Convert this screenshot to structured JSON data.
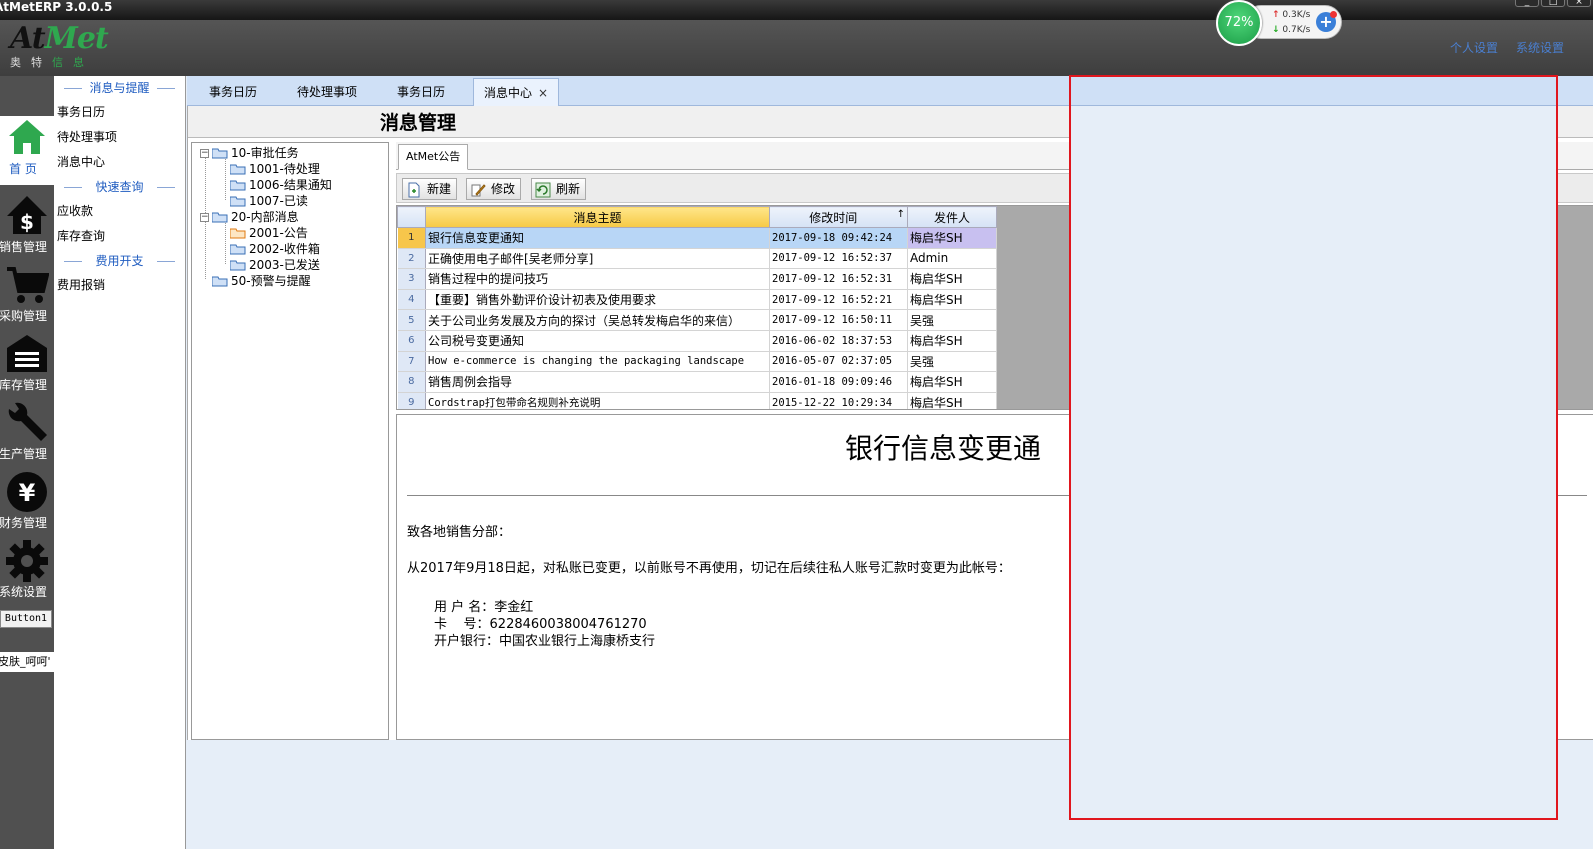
{
  "app": {
    "title": "AtMetERP 3.0.0.5",
    "window_buttons": [
      "_",
      "□",
      "×"
    ]
  },
  "logo": {
    "mark_a": "At",
    "mark_b": "Met",
    "sub_a": "奥特",
    "sub_b": "信息"
  },
  "header": {
    "personal_settings": "个人设置",
    "system_settings": "系统设置"
  },
  "net_widget": {
    "percent": "72%",
    "up": "0.3K/s",
    "down": "0.7K/s",
    "plus": "+"
  },
  "nav": [
    {
      "label": "首 页",
      "icon": "home-icon"
    },
    {
      "label": "销售管理",
      "icon": "dollar-house-icon"
    },
    {
      "label": "采购管理",
      "icon": "cart-icon"
    },
    {
      "label": "库存管理",
      "icon": "warehouse-icon"
    },
    {
      "label": "生产管理",
      "icon": "wrench-icon"
    },
    {
      "label": "财务管理",
      "icon": "yen-icon"
    },
    {
      "label": "系统设置",
      "icon": "gear-icon"
    }
  ],
  "button1": "Button1",
  "skin": "皮肤_呵呵'",
  "menu": {
    "sec1": "消息与提醒",
    "items1": [
      "事务日历",
      "待处理事项",
      "消息中心"
    ],
    "sec2": "快速查询",
    "items2": [
      "应收款",
      "库存查询"
    ],
    "sec3": "费用开支",
    "items3": [
      "费用报销"
    ]
  },
  "tabs": [
    {
      "label": "事务日历"
    },
    {
      "label": "待处理事项"
    },
    {
      "label": "事务日历"
    },
    {
      "label": "消息中心",
      "close": "×"
    }
  ],
  "page_title": "消息管理",
  "tree": {
    "n1": "10-审批任务",
    "n1a": "1001-待处理",
    "n1b": "1006-结果通知",
    "n1c": "1007-已读",
    "n2": "20-内部消息",
    "n2a": "2001-公告",
    "n2b": "2002-收件箱",
    "n2c": "2003-已发送",
    "n3": "50-预警与提醒"
  },
  "subtab": "AtMet公告",
  "toolbar": {
    "new": "新建",
    "edit": "修改",
    "refresh": "刷新"
  },
  "grid": {
    "headers": [
      "消息主题",
      "修改时间",
      "发件人"
    ],
    "sort_arrow": "↑",
    "rows": [
      {
        "n": "1",
        "subject": "银行信息变更通知",
        "time": "2017-09-18 09:42:24",
        "sender": "梅启华SH"
      },
      {
        "n": "2",
        "subject": "正确使用电子邮件[吴老师分享]",
        "time": "2017-09-12 16:52:37",
        "sender": "Admin"
      },
      {
        "n": "3",
        "subject": "销售过程中的提问技巧",
        "time": "2017-09-12 16:52:31",
        "sender": "梅启华SH"
      },
      {
        "n": "4",
        "subject": "【重要】销售外勤评价设计初表及使用要求",
        "time": "2017-09-12 16:52:21",
        "sender": "梅启华SH"
      },
      {
        "n": "5",
        "subject": "关于公司业务发展及方向的探讨（吴总转发梅启华的来信）",
        "time": "2017-09-12 16:50:11",
        "sender": "吴强"
      },
      {
        "n": "6",
        "subject": "公司税号变更通知",
        "time": "2016-06-02 18:37:53",
        "sender": "梅启华SH"
      },
      {
        "n": "7",
        "subject": "How e-commerce is changing the packaging landscape",
        "time": "2016-05-07 02:37:05",
        "sender": "吴强"
      },
      {
        "n": "8",
        "subject": "销售周例会指导",
        "time": "2016-01-18 09:09:46",
        "sender": "梅启华SH"
      },
      {
        "n": "9",
        "subject": "Cordstrap打包带命名规则补充说明",
        "time": "2015-12-22 10:29:34",
        "sender": "梅启华SH"
      }
    ]
  },
  "doc": {
    "title": "银行信息变更通",
    "greeting": "致各地销售分部：",
    "body": "从2017年9月18日起，对私账已变更，以前账号不再使用，切记在后续往私人账号汇款时变更为此帐号：",
    "line1": "用 户 名：李金红",
    "line2": "卡    号：6228460038004761270",
    "line3": "开户银行：中国农业银行上海康桥支行"
  }
}
